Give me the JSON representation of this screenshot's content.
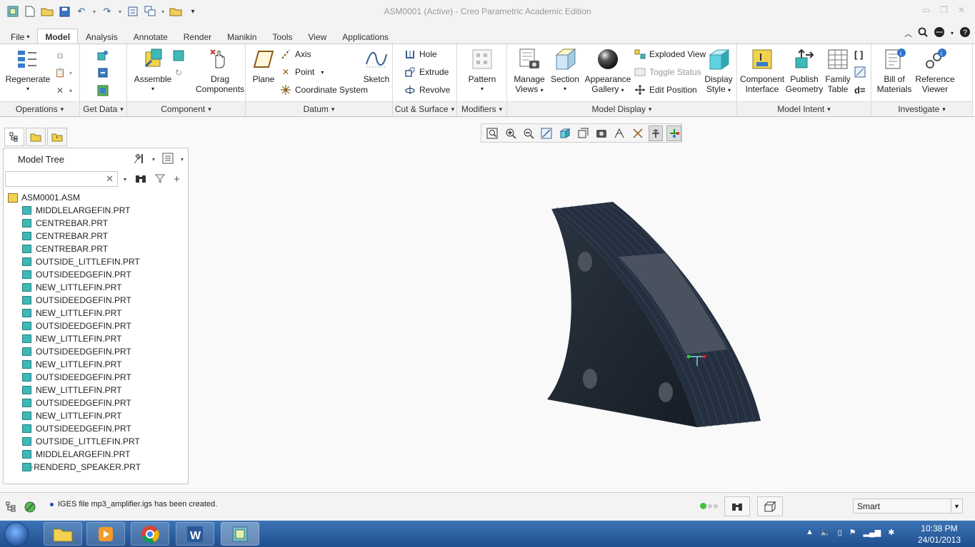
{
  "window": {
    "title": "ASM0001 (Active) - Creo Parametric Academic Edition"
  },
  "tabs": [
    "File",
    "Model",
    "Analysis",
    "Annotate",
    "Render",
    "Manikin",
    "Tools",
    "View",
    "Applications"
  ],
  "ribbon": {
    "operations": {
      "footer": "Operations",
      "regenerate": "Regenerate"
    },
    "get_data": {
      "footer": "Get Data"
    },
    "component": {
      "footer": "Component",
      "assemble": "Assemble",
      "drag1": "Drag",
      "drag2": "Components"
    },
    "datum": {
      "footer": "Datum",
      "plane": "Plane",
      "axis": "Axis",
      "point": "Point",
      "csys": "Coordinate System",
      "sketch": "Sketch"
    },
    "cut_surface": {
      "footer": "Cut & Surface",
      "hole": "Hole",
      "extrude": "Extrude",
      "revolve": "Revolve"
    },
    "modifiers": {
      "footer": "Modifiers",
      "pattern": "Pattern"
    },
    "model_display": {
      "footer": "Model Display",
      "manage1": "Manage",
      "manage2": "Views",
      "section": "Section",
      "appearance1": "Appearance",
      "appearance2": "Gallery",
      "exploded": "Exploded View",
      "toggle_status": "Toggle Status",
      "edit_position": "Edit Position",
      "display1": "Display",
      "display2": "Style"
    },
    "model_intent": {
      "footer": "Model Intent",
      "ci1": "Component",
      "ci2": "Interface",
      "pg1": "Publish",
      "pg2": "Geometry",
      "ft1": "Family",
      "ft2": "Table"
    },
    "investigate": {
      "footer": "Investigate",
      "bom1": "Bill of",
      "bom2": "Materials",
      "rv1": "Reference",
      "rv2": "Viewer"
    }
  },
  "model_tree": {
    "title": "Model Tree",
    "search_placeholder": "",
    "root": "ASM0001.ASM",
    "items": [
      "MIDDLELARGEFIN.PRT",
      "CENTREBAR.PRT",
      "CENTREBAR.PRT",
      "CENTREBAR.PRT",
      "OUTSIDE_LITTLEFIN.PRT",
      "OUTSIDEEDGEFIN.PRT",
      "NEW_LITTLEFIN.PRT",
      "OUTSIDEEDGEFIN.PRT",
      "NEW_LITTLEFIN.PRT",
      "OUTSIDEEDGEFIN.PRT",
      "NEW_LITTLEFIN.PRT",
      "OUTSIDEEDGEFIN.PRT",
      "NEW_LITTLEFIN.PRT",
      "OUTSIDEEDGEFIN.PRT",
      "NEW_LITTLEFIN.PRT",
      "OUTSIDEEDGEFIN.PRT",
      "NEW_LITTLEFIN.PRT",
      "OUTSIDEEDGEFIN.PRT",
      "OUTSIDE_LITTLEFIN.PRT",
      "MIDDLELARGEFIN.PRT",
      "RENDERD_SPEAKER.PRT"
    ]
  },
  "status": {
    "message": "IGES file mp3_amplifier.igs has been created.",
    "filter": "Smart"
  },
  "taskbar": {
    "time": "10:38 PM",
    "date": "24/01/2013"
  },
  "colors": {
    "model": "#1d2631",
    "accent": "#3a5f8f",
    "part_icon": "#3fb8b8"
  }
}
